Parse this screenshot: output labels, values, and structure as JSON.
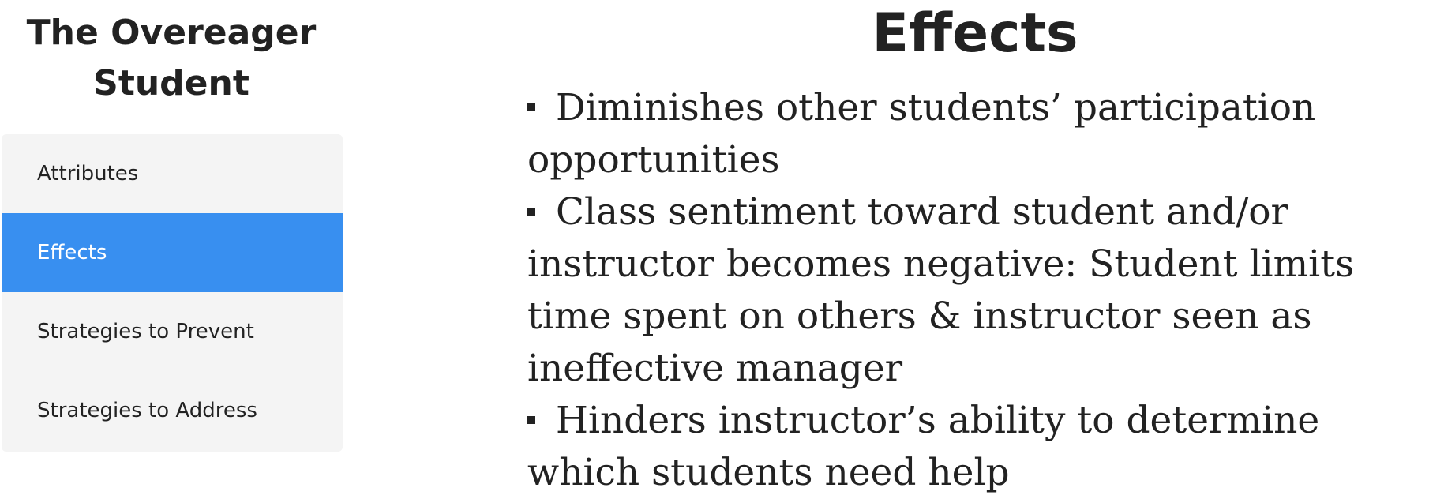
{
  "sidebar": {
    "title_line1": "The Overeager",
    "title_line2": "Student",
    "items": [
      {
        "label": "Attributes",
        "active": false
      },
      {
        "label": "Effects",
        "active": true
      },
      {
        "label": "Strategies to Prevent",
        "active": false
      },
      {
        "label": "Strategies to Address",
        "active": false
      }
    ]
  },
  "main": {
    "title": "Effects",
    "bullets": [
      "Diminishes other students’ participation opportunities",
      "Class sentiment toward student and/or instructor becomes negative: Student limits time spent on others & instructor seen as ineffective manager",
      "Hinders instructor’s ability to determine which students need help"
    ]
  },
  "colors": {
    "accent": "#388ff0",
    "menu_background": "#f4f4f4",
    "text": "#222222"
  }
}
